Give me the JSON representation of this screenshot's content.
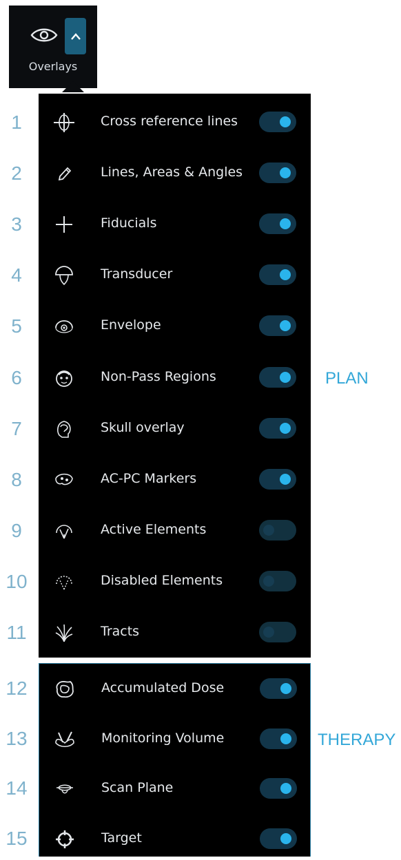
{
  "header": {
    "label": "Overlays",
    "eye_icon": "eye-icon",
    "toggle_icon": "chevron-up-icon"
  },
  "colors": {
    "accent": "#2ab4ec",
    "panel_bg": "#000000",
    "number_color": "#7fb2cc",
    "section_label": "#33a7d8"
  },
  "sections": {
    "plan": "PLAN",
    "therapy": "THERAPY"
  },
  "plan_items": [
    {
      "num": "1",
      "label": "Cross reference lines",
      "icon": "crosshair-lines-icon",
      "on": true
    },
    {
      "num": "2",
      "label": "Lines, Areas & Angles",
      "icon": "pencil-icon",
      "on": true
    },
    {
      "num": "3",
      "label": "Fiducials",
      "icon": "plus-icon",
      "on": true
    },
    {
      "num": "4",
      "label": "Transducer",
      "icon": "transducer-icon",
      "on": true
    },
    {
      "num": "5",
      "label": "Envelope",
      "icon": "envelope-icon",
      "on": true
    },
    {
      "num": "6",
      "label": "Non-Pass Regions",
      "icon": "non-pass-regions-icon",
      "on": true
    },
    {
      "num": "7",
      "label": "Skull overlay",
      "icon": "skull-icon",
      "on": true
    },
    {
      "num": "8",
      "label": "AC-PC Markers",
      "icon": "ac-pc-markers-icon",
      "on": true
    },
    {
      "num": "9",
      "label": "Active Elements",
      "icon": "active-elements-icon",
      "on": false
    },
    {
      "num": "10",
      "label": "Disabled Elements",
      "icon": "disabled-elements-icon",
      "on": false
    },
    {
      "num": "11",
      "label": "Tracts",
      "icon": "tracts-icon",
      "on": false
    }
  ],
  "therapy_items": [
    {
      "num": "12",
      "label": "Accumulated Dose",
      "icon": "accumulated-dose-icon",
      "on": true
    },
    {
      "num": "13",
      "label": "Monitoring Volume",
      "icon": "monitoring-volume-icon",
      "on": true
    },
    {
      "num": "14",
      "label": "Scan Plane",
      "icon": "scan-plane-icon",
      "on": true
    },
    {
      "num": "15",
      "label": "Target",
      "icon": "target-icon",
      "on": true
    }
  ]
}
